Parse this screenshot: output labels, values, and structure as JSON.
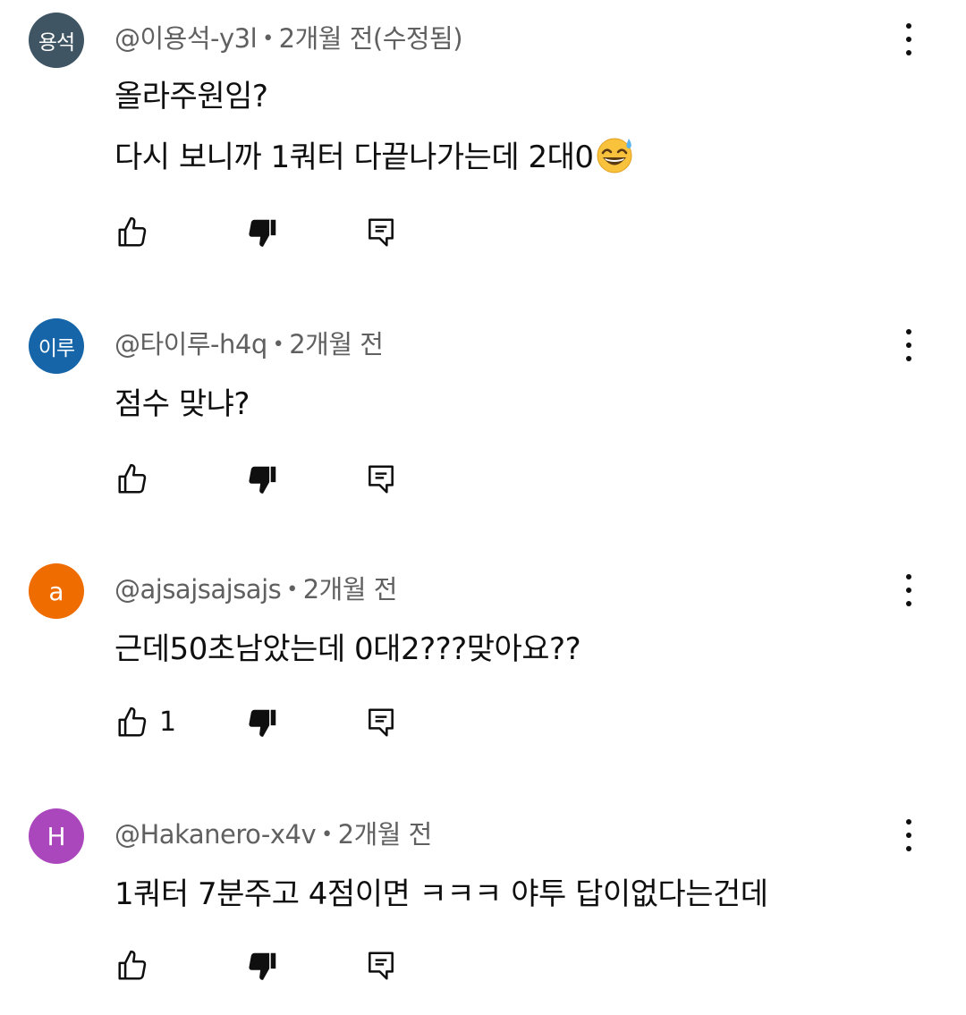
{
  "comments": [
    {
      "avatar_text": "용석",
      "avatar_color": "#3f5563",
      "author": "@이용석-y3l",
      "separator": "•",
      "time": "2개월 전(수정됨)",
      "lines": [
        "올라주원임?",
        "다시 보니까 1쿼터 다끝나가는데 2대0"
      ],
      "emoji": "grinning-sweat-emoji",
      "likes": ""
    },
    {
      "avatar_text": "이루",
      "avatar_color": "#1565a8",
      "author": "@타이루-h4q",
      "separator": "•",
      "time": "2개월 전",
      "lines": [
        "점수 맞냐?"
      ],
      "likes": ""
    },
    {
      "avatar_text": "a",
      "avatar_color": "#ef6c00",
      "author": "@ajsajsajsajs",
      "separator": "•",
      "time": "2개월 전",
      "lines": [
        "근데50초남았는데 0대2???맞아요??"
      ],
      "likes": "1"
    },
    {
      "avatar_text": "H",
      "avatar_color": "#ab47bc",
      "author": "@Hakanero-x4v",
      "separator": "•",
      "time": "2개월 전",
      "lines": [
        "1쿼터 7분주고 4점이면 ㅋㅋㅋ 야투 답이없다는건데"
      ],
      "likes": ""
    }
  ],
  "icons": {
    "like": "thumb-up-icon",
    "dislike": "thumb-down-icon",
    "reply": "reply-icon",
    "menu": "more-vert-icon"
  }
}
